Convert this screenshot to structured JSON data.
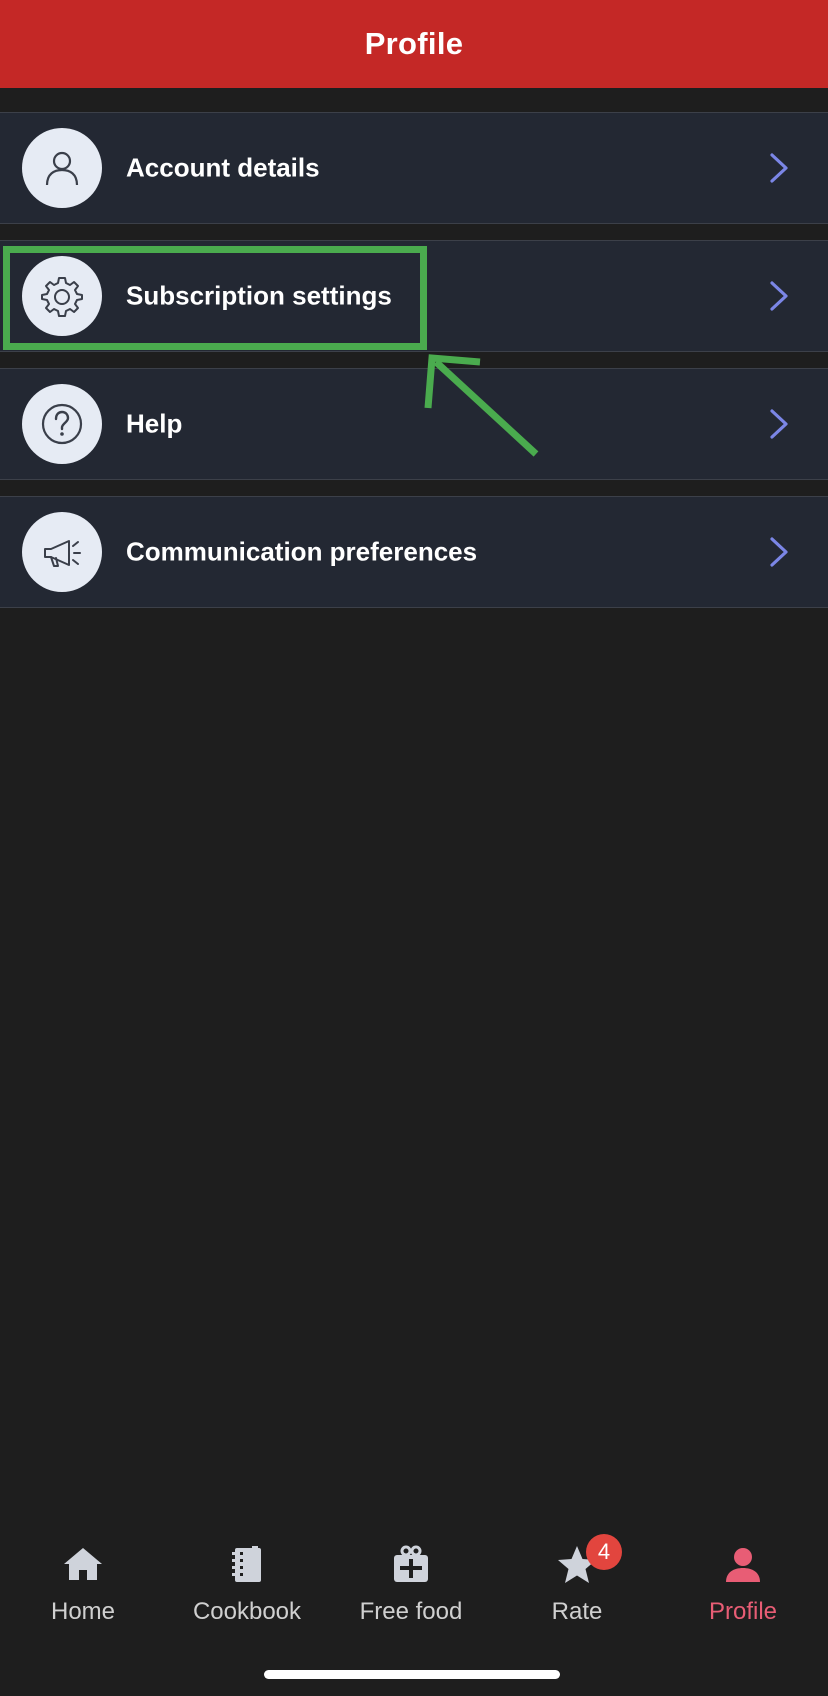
{
  "header": {
    "title": "Profile"
  },
  "menu": {
    "items": [
      {
        "label": "Account details",
        "icon": "user-icon"
      },
      {
        "label": "Subscription settings",
        "icon": "gear-icon"
      },
      {
        "label": "Help",
        "icon": "question-icon"
      },
      {
        "label": "Communication preferences",
        "icon": "megaphone-icon"
      }
    ]
  },
  "tabs": [
    {
      "label": "Home",
      "icon": "home-icon",
      "active": false
    },
    {
      "label": "Cookbook",
      "icon": "cookbook-icon",
      "active": false
    },
    {
      "label": "Free food",
      "icon": "gift-icon",
      "active": false
    },
    {
      "label": "Rate",
      "icon": "star-icon",
      "active": false,
      "badge": "4"
    },
    {
      "label": "Profile",
      "icon": "profile-icon",
      "active": true
    }
  ],
  "colors": {
    "header_bg": "#c42826",
    "row_bg": "#232833",
    "chevron": "#7b86e6",
    "highlight": "#4aab4e",
    "active_tab": "#e85d75",
    "badge": "#e2453e"
  }
}
